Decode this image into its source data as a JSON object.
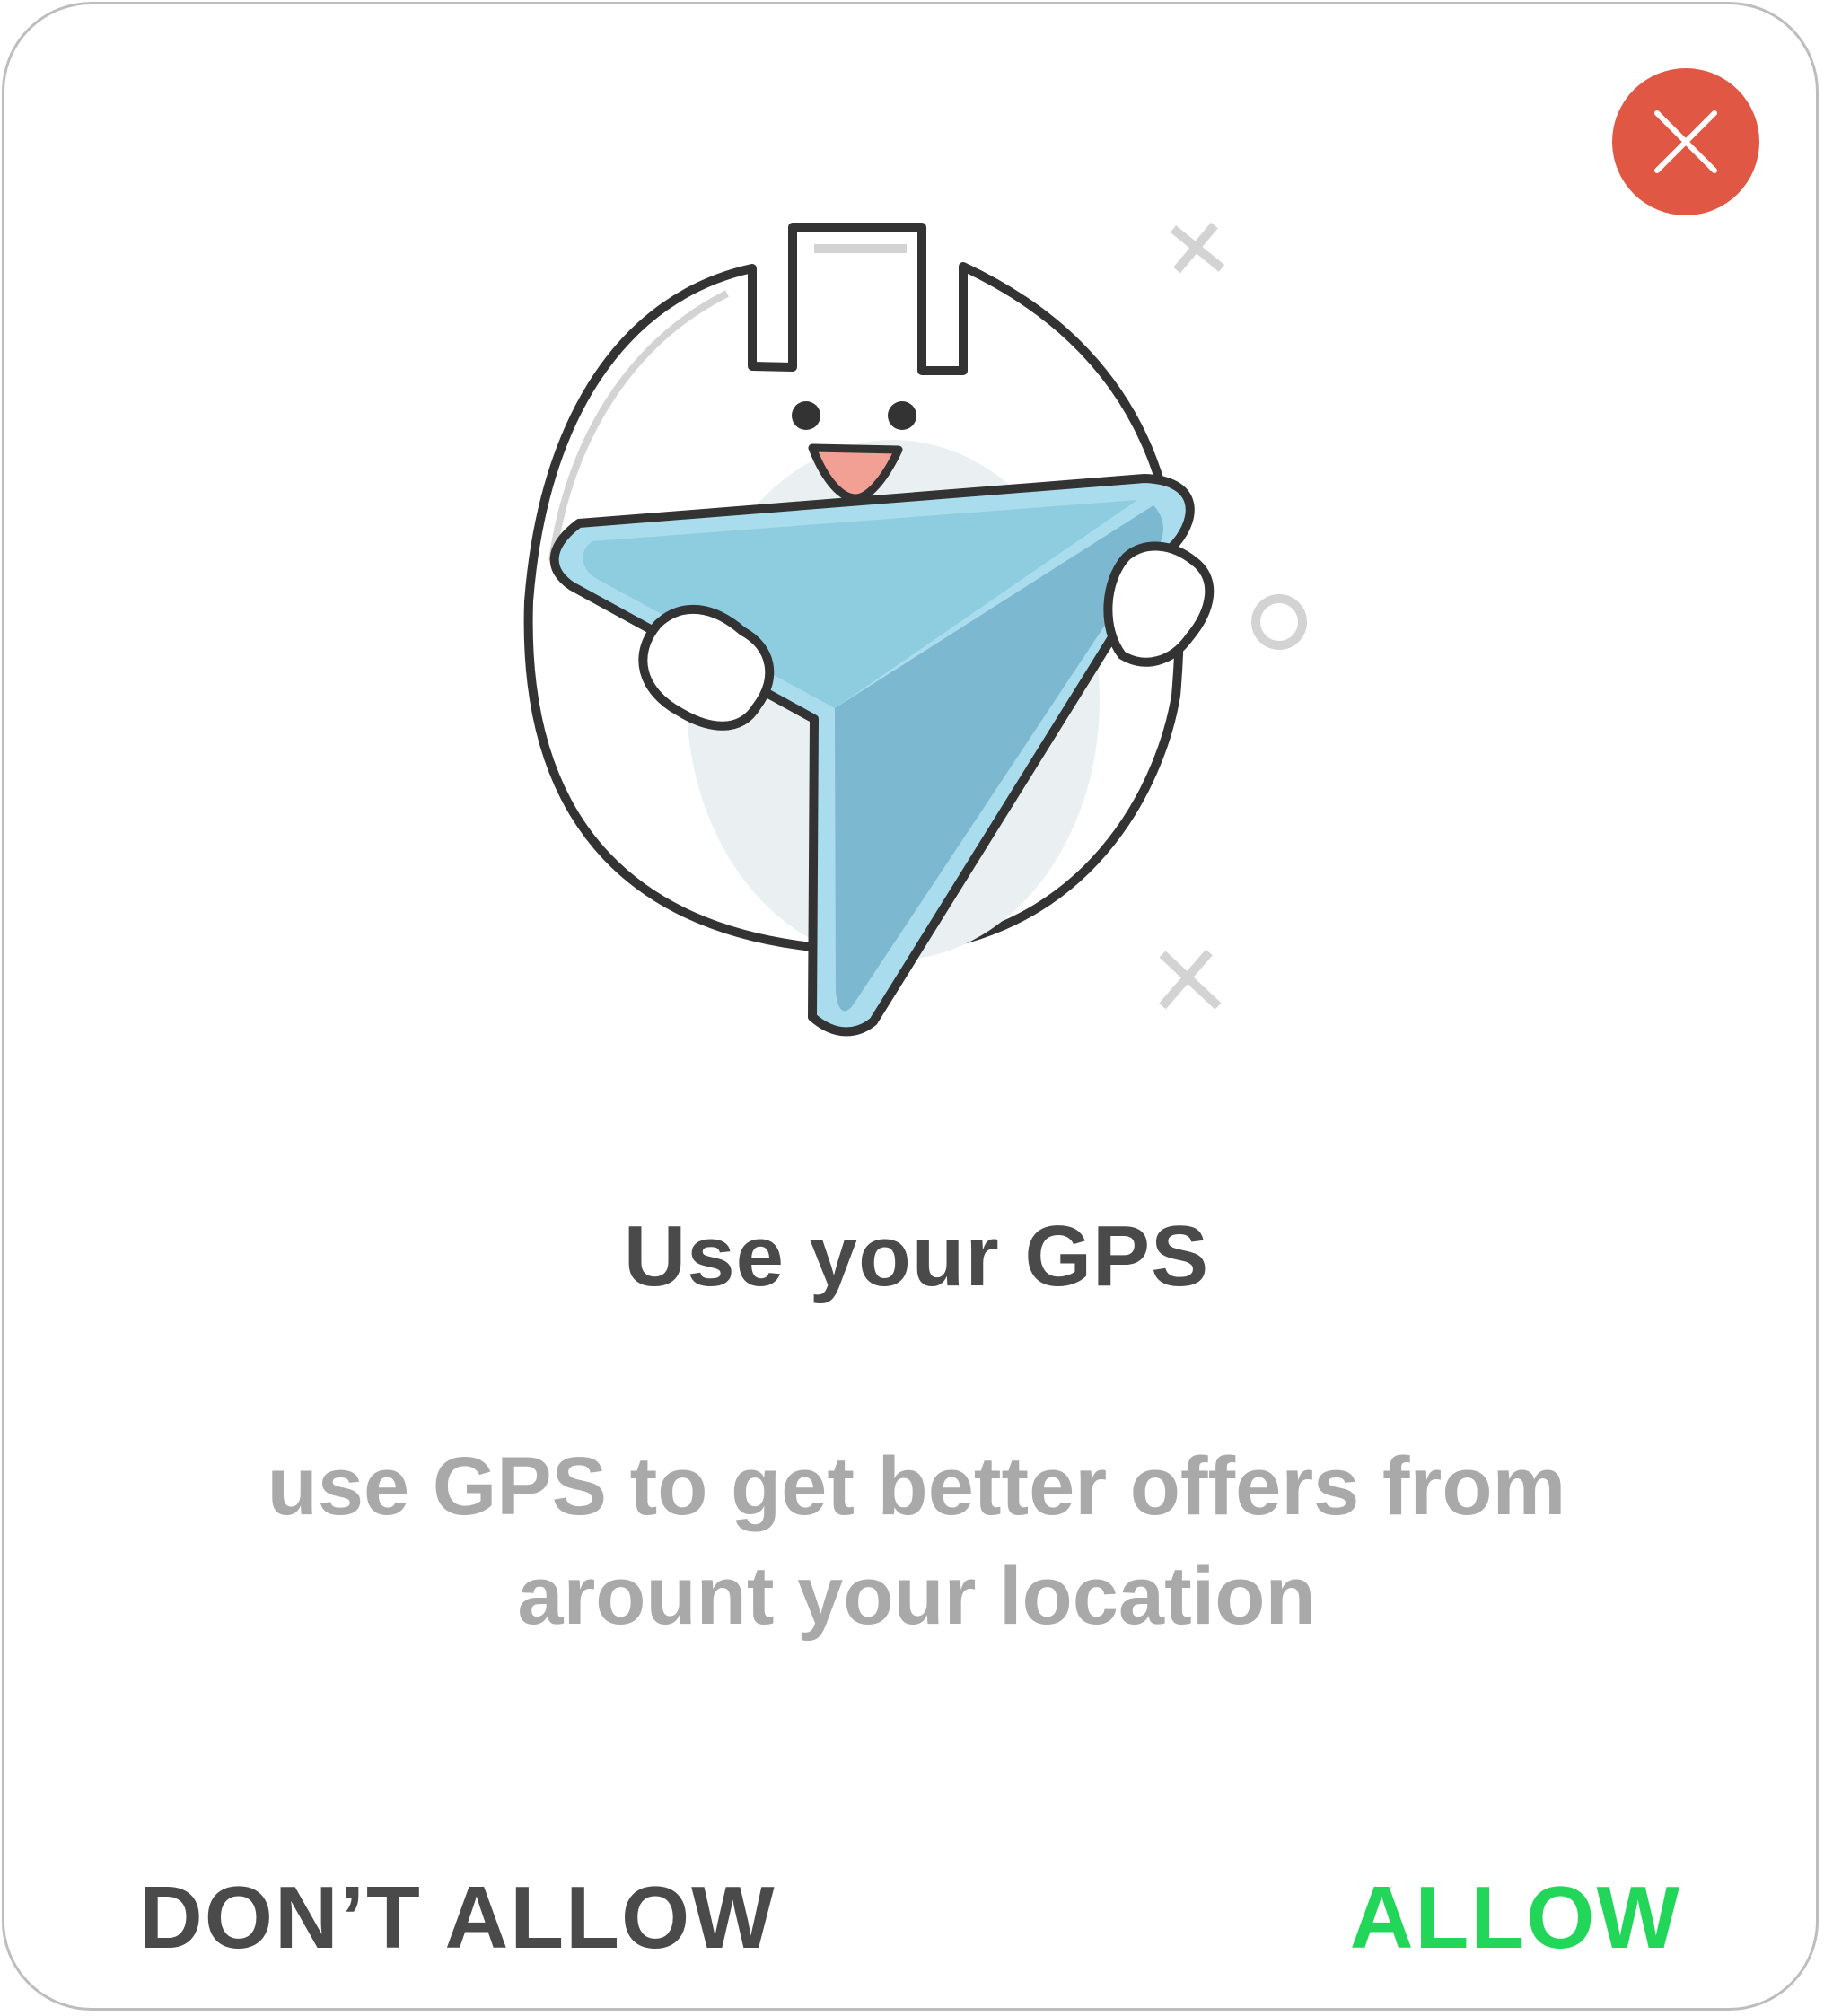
{
  "dialog": {
    "title": "Use your GPS",
    "message": "use GPS to get better offers from arount your location",
    "deny_label": "DON’T ALLOW",
    "allow_label": "ALLOW"
  },
  "icons": {
    "close": "close-icon",
    "illustration": "gps-mascot-illustration"
  },
  "colors": {
    "close_bg": "#e05744",
    "title": "#4a4a4a",
    "message": "#a9a9a9",
    "deny": "#4a4a4a",
    "allow": "#22d65a",
    "arrow_light": "#8ecddf",
    "arrow_dark": "#7db8d1",
    "outline": "#333333"
  }
}
